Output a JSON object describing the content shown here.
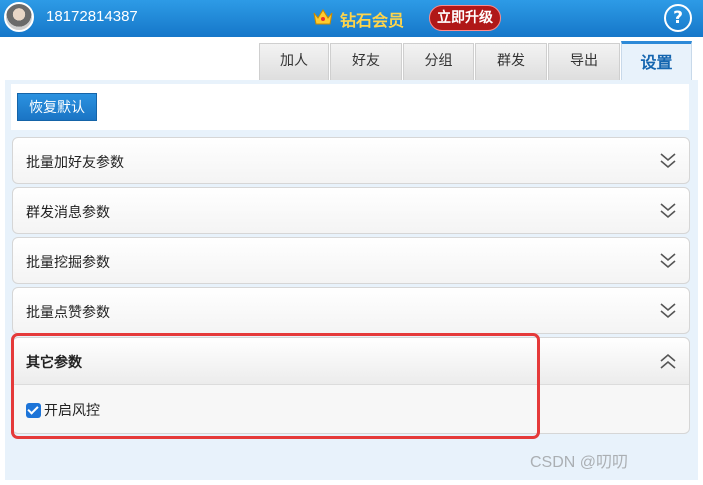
{
  "titlebar": {
    "phone": "18172814387",
    "vip_label": "钻石会员",
    "upgrade_label": "立即升级",
    "help_label": "?"
  },
  "tabs": [
    {
      "label": "加人",
      "active": false
    },
    {
      "label": "好友",
      "active": false
    },
    {
      "label": "分组",
      "active": false
    },
    {
      "label": "群发",
      "active": false
    },
    {
      "label": "导出",
      "active": false
    },
    {
      "label": "设置",
      "active": true
    }
  ],
  "toolbar": {
    "reset_label": "恢复默认"
  },
  "sections": [
    {
      "label": "批量加好友参数",
      "expanded": false,
      "icon": "chevron-down-icon"
    },
    {
      "label": "群发消息参数",
      "expanded": false,
      "icon": "chevron-down-icon"
    },
    {
      "label": "批量挖掘参数",
      "expanded": false,
      "icon": "chevron-down-icon"
    },
    {
      "label": "批量点赞参数",
      "expanded": false,
      "icon": "chevron-down-icon"
    },
    {
      "label": "其它参数",
      "expanded": true,
      "icon": "chevron-up-icon",
      "options": [
        {
          "label": "开启风控",
          "checked": true
        }
      ]
    }
  ],
  "watermark": "CSDN @叨叨",
  "colors": {
    "titlebar": "#1f86d6",
    "accent": "#1d74d8",
    "vip_gold": "#ffd54a",
    "upgrade_red": "#b01818",
    "highlight_red": "#e53a3a"
  }
}
